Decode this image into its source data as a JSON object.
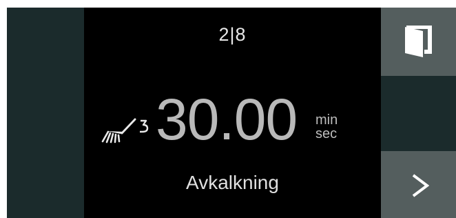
{
  "step_indicator": "2|8",
  "timer": {
    "value": "30.00",
    "unit_top": "min",
    "unit_bottom": "sec"
  },
  "program_label": "Avkalkning",
  "icons": {
    "top_right": "door-icon",
    "bottom_right": "play-arrow-icon",
    "program": "descaling-brush-icon"
  },
  "colors": {
    "side_panel": "#1b2b2c",
    "button": "#545e5e",
    "display_bg": "#000000"
  }
}
